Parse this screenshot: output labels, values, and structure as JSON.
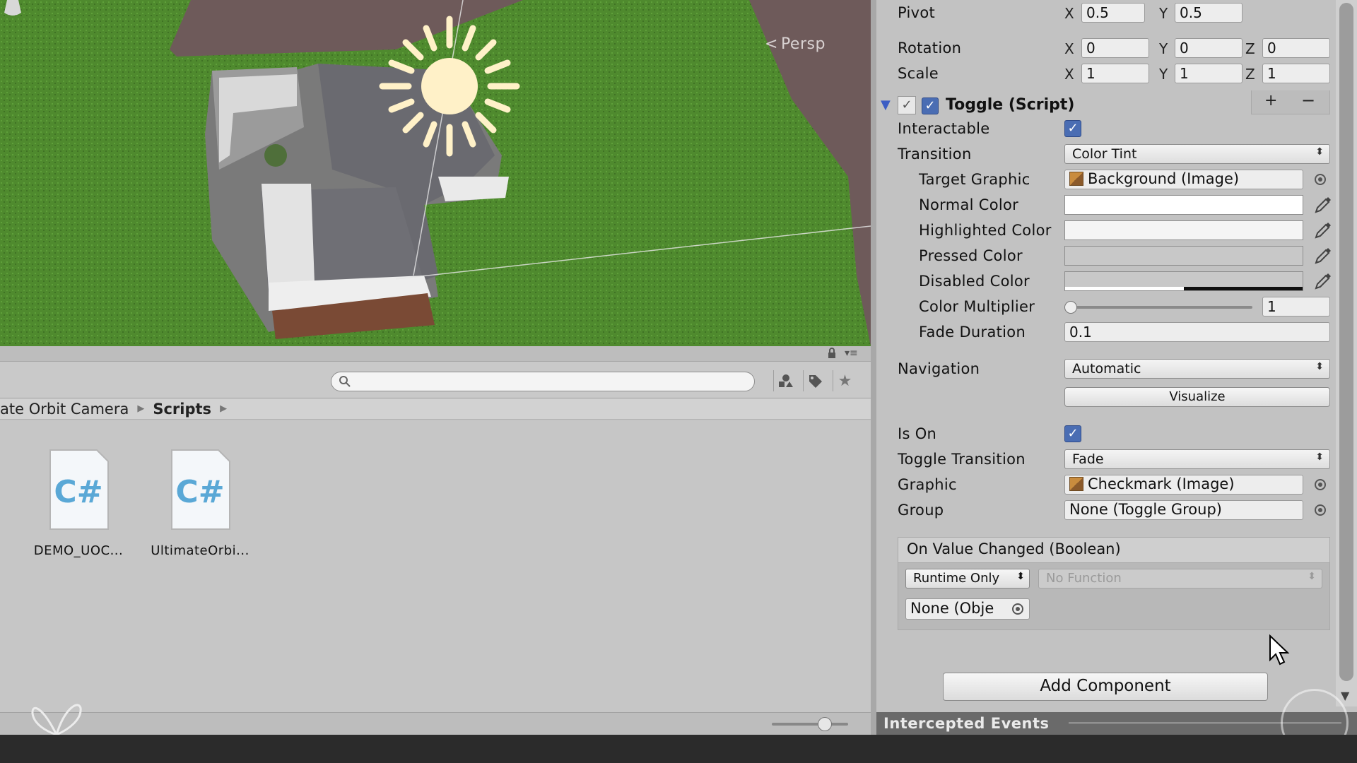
{
  "scene": {
    "persp_label": "Persp"
  },
  "project": {
    "search": {
      "value": "",
      "placeholder": ""
    },
    "breadcrumb": [
      {
        "label": "Ultimate Orbit Camera",
        "visible_label": "ate Orbit Camera"
      },
      {
        "label": "Scripts"
      }
    ],
    "files": [
      {
        "name": "DEMO_UOC...",
        "type": "C#"
      },
      {
        "name": "UltimateOrbi...",
        "type": "C#"
      }
    ]
  },
  "inspector": {
    "transform": {
      "pivot": {
        "label": "Pivot",
        "x": "0.5",
        "y": "0.5"
      },
      "rotation": {
        "label": "Rotation",
        "x": "0",
        "y": "0",
        "z": "0"
      },
      "scale": {
        "label": "Scale",
        "x": "1",
        "y": "1",
        "z": "1"
      },
      "axis_x": "X",
      "axis_y": "Y",
      "axis_z": "Z"
    },
    "toggle": {
      "title": "Toggle (Script)",
      "enabled": true,
      "interactable": {
        "label": "Interactable",
        "checked": true
      },
      "transition": {
        "label": "Transition",
        "value": "Color Tint"
      },
      "target_graphic": {
        "label": "Target Graphic",
        "value": "Background (Image)"
      },
      "normal_color": {
        "label": "Normal Color",
        "hex": "#ffffff"
      },
      "highlighted_color": {
        "label": "Highlighted Color",
        "hex": "#f5f5f5"
      },
      "pressed_color": {
        "label": "Pressed Color",
        "hex": "#c8c8c8"
      },
      "disabled_color": {
        "label": "Disabled Color",
        "hex": "#c8c8c8",
        "alpha": 0.5
      },
      "color_multiplier": {
        "label": "Color Multiplier",
        "value": "1",
        "slider_fraction": 0.0
      },
      "fade_duration": {
        "label": "Fade Duration",
        "value": "0.1"
      },
      "navigation": {
        "label": "Navigation",
        "value": "Automatic"
      },
      "visualize_label": "Visualize",
      "is_on": {
        "label": "Is On",
        "checked": true
      },
      "toggle_transition": {
        "label": "Toggle Transition",
        "value": "Fade"
      },
      "graphic": {
        "label": "Graphic",
        "value": "Checkmark (Image)"
      },
      "group": {
        "label": "Group",
        "value": "None (Toggle Group)"
      },
      "on_value_changed": {
        "title": "On Value Changed (Boolean)",
        "runtime": "Runtime Only",
        "function": "No Function",
        "object": "None (Obje"
      }
    },
    "add_component_label": "Add Component",
    "intercepted_events_label": "Intercepted Events"
  },
  "icons": {
    "search": "search-icon",
    "lock": "lock-icon",
    "eyedropper": "eyedropper-icon",
    "target": "object-picker-icon",
    "gear": "gear-icon",
    "help": "help-book-icon"
  },
  "colors": {
    "accent": "#4a6db3",
    "grass": "#4f8a2e",
    "background": "#c2c2c2"
  }
}
